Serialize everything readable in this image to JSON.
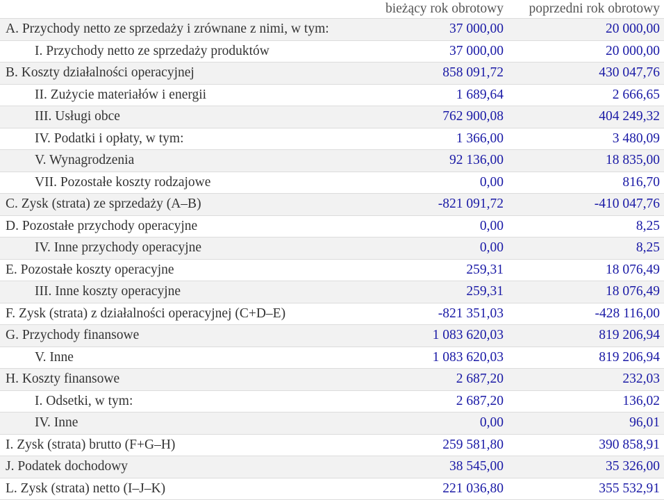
{
  "header": {
    "col_current": "bieżący rok obrotowy",
    "col_previous": "poprzedni rok obrotowy"
  },
  "rows": [
    {
      "label": "A. Przychody netto ze sprzedaży i zrównane z nimi, w tym:",
      "current": "37 000,00",
      "previous": "20 000,00",
      "sub": false
    },
    {
      "label": "I. Przychody netto ze sprzedaży produktów",
      "current": "37 000,00",
      "previous": "20 000,00",
      "sub": true
    },
    {
      "label": "B. Koszty działalności operacyjnej",
      "current": "858 091,72",
      "previous": "430 047,76",
      "sub": false
    },
    {
      "label": "II. Zużycie materiałów i energii",
      "current": "1 689,64",
      "previous": "2 666,65",
      "sub": true
    },
    {
      "label": "III. Usługi obce",
      "current": "762 900,08",
      "previous": "404 249,32",
      "sub": true
    },
    {
      "label": "IV. Podatki i opłaty, w tym:",
      "current": "1 366,00",
      "previous": "3 480,09",
      "sub": true
    },
    {
      "label": "V. Wynagrodzenia",
      "current": "92 136,00",
      "previous": "18 835,00",
      "sub": true
    },
    {
      "label": "VII. Pozostałe koszty rodzajowe",
      "current": "0,00",
      "previous": "816,70",
      "sub": true
    },
    {
      "label": "C. Zysk (strata) ze sprzedaży (A–B)",
      "current": "-821 091,72",
      "previous": "-410 047,76",
      "sub": false
    },
    {
      "label": "D. Pozostałe przychody operacyjne",
      "current": "0,00",
      "previous": "8,25",
      "sub": false
    },
    {
      "label": "IV. Inne przychody operacyjne",
      "current": "0,00",
      "previous": "8,25",
      "sub": true
    },
    {
      "label": "E. Pozostałe koszty operacyjne",
      "current": "259,31",
      "previous": "18 076,49",
      "sub": false
    },
    {
      "label": "III. Inne koszty operacyjne",
      "current": "259,31",
      "previous": "18 076,49",
      "sub": true
    },
    {
      "label": "F. Zysk (strata) z działalności operacyjnej (C+D–E)",
      "current": "-821 351,03",
      "previous": "-428 116,00",
      "sub": false
    },
    {
      "label": "G. Przychody finansowe",
      "current": "1 083 620,03",
      "previous": "819 206,94",
      "sub": false
    },
    {
      "label": "V. Inne",
      "current": "1 083 620,03",
      "previous": "819 206,94",
      "sub": true
    },
    {
      "label": "H. Koszty finansowe",
      "current": "2 687,20",
      "previous": "232,03",
      "sub": false
    },
    {
      "label": "I. Odsetki, w tym:",
      "current": "2 687,20",
      "previous": "136,02",
      "sub": true
    },
    {
      "label": "IV. Inne",
      "current": "0,00",
      "previous": "96,01",
      "sub": true
    },
    {
      "label": "I. Zysk (strata) brutto (F+G–H)",
      "current": "259 581,80",
      "previous": "390 858,91",
      "sub": false
    },
    {
      "label": "J. Podatek dochodowy",
      "current": "38 545,00",
      "previous": "35 326,00",
      "sub": false
    },
    {
      "label": "L. Zysk (strata) netto (I–J–K)",
      "current": "221 036,80",
      "previous": "355 532,91",
      "sub": false
    }
  ],
  "colors": {
    "number_text": "#1a1aa6",
    "zebra_row": "#f2f2f2",
    "label_text": "#333333"
  }
}
